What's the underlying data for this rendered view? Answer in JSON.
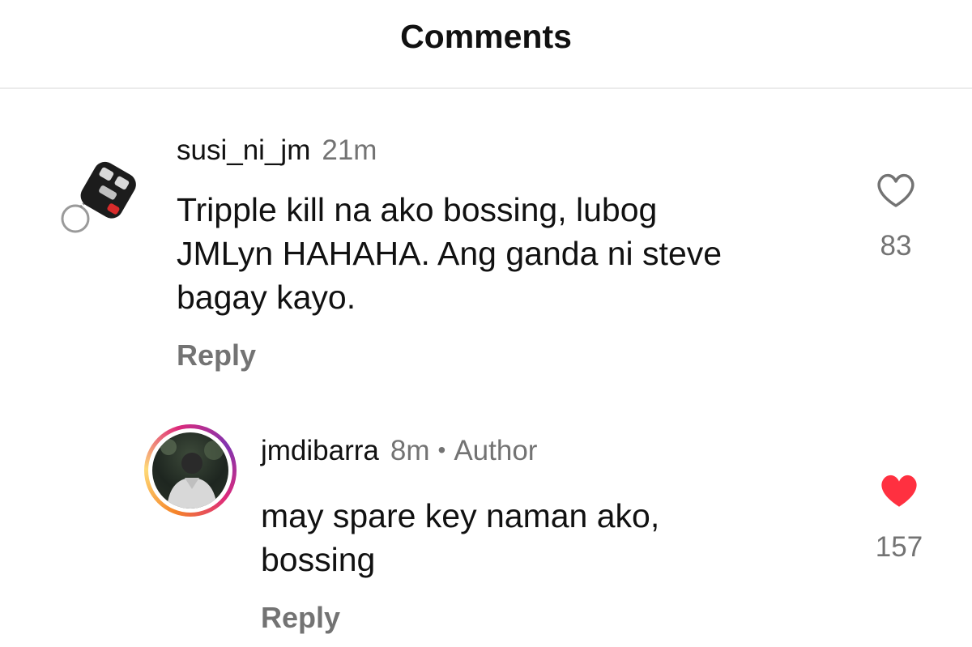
{
  "header": {
    "title": "Comments"
  },
  "comments": [
    {
      "username": "susi_ni_jm",
      "time": "21m",
      "text_lines": [
        "Tripple kill na ako bossing, lubog",
        "JMLyn HAHAHA. Ang ganda ni steve",
        "bagay kayo."
      ],
      "reply_label": "Reply",
      "like_count": "83",
      "liked": false,
      "avatar": "car-key-fob-icon"
    },
    {
      "username": "jmdibarra",
      "time": "8m",
      "separator": "•",
      "badge": "Author",
      "text_lines": [
        "may spare key naman ako,",
        "bossing"
      ],
      "reply_label": "Reply",
      "like_count": "157",
      "liked": true,
      "like_color": "#ff3040",
      "avatar": "profile-photo-with-story-ring"
    }
  ]
}
